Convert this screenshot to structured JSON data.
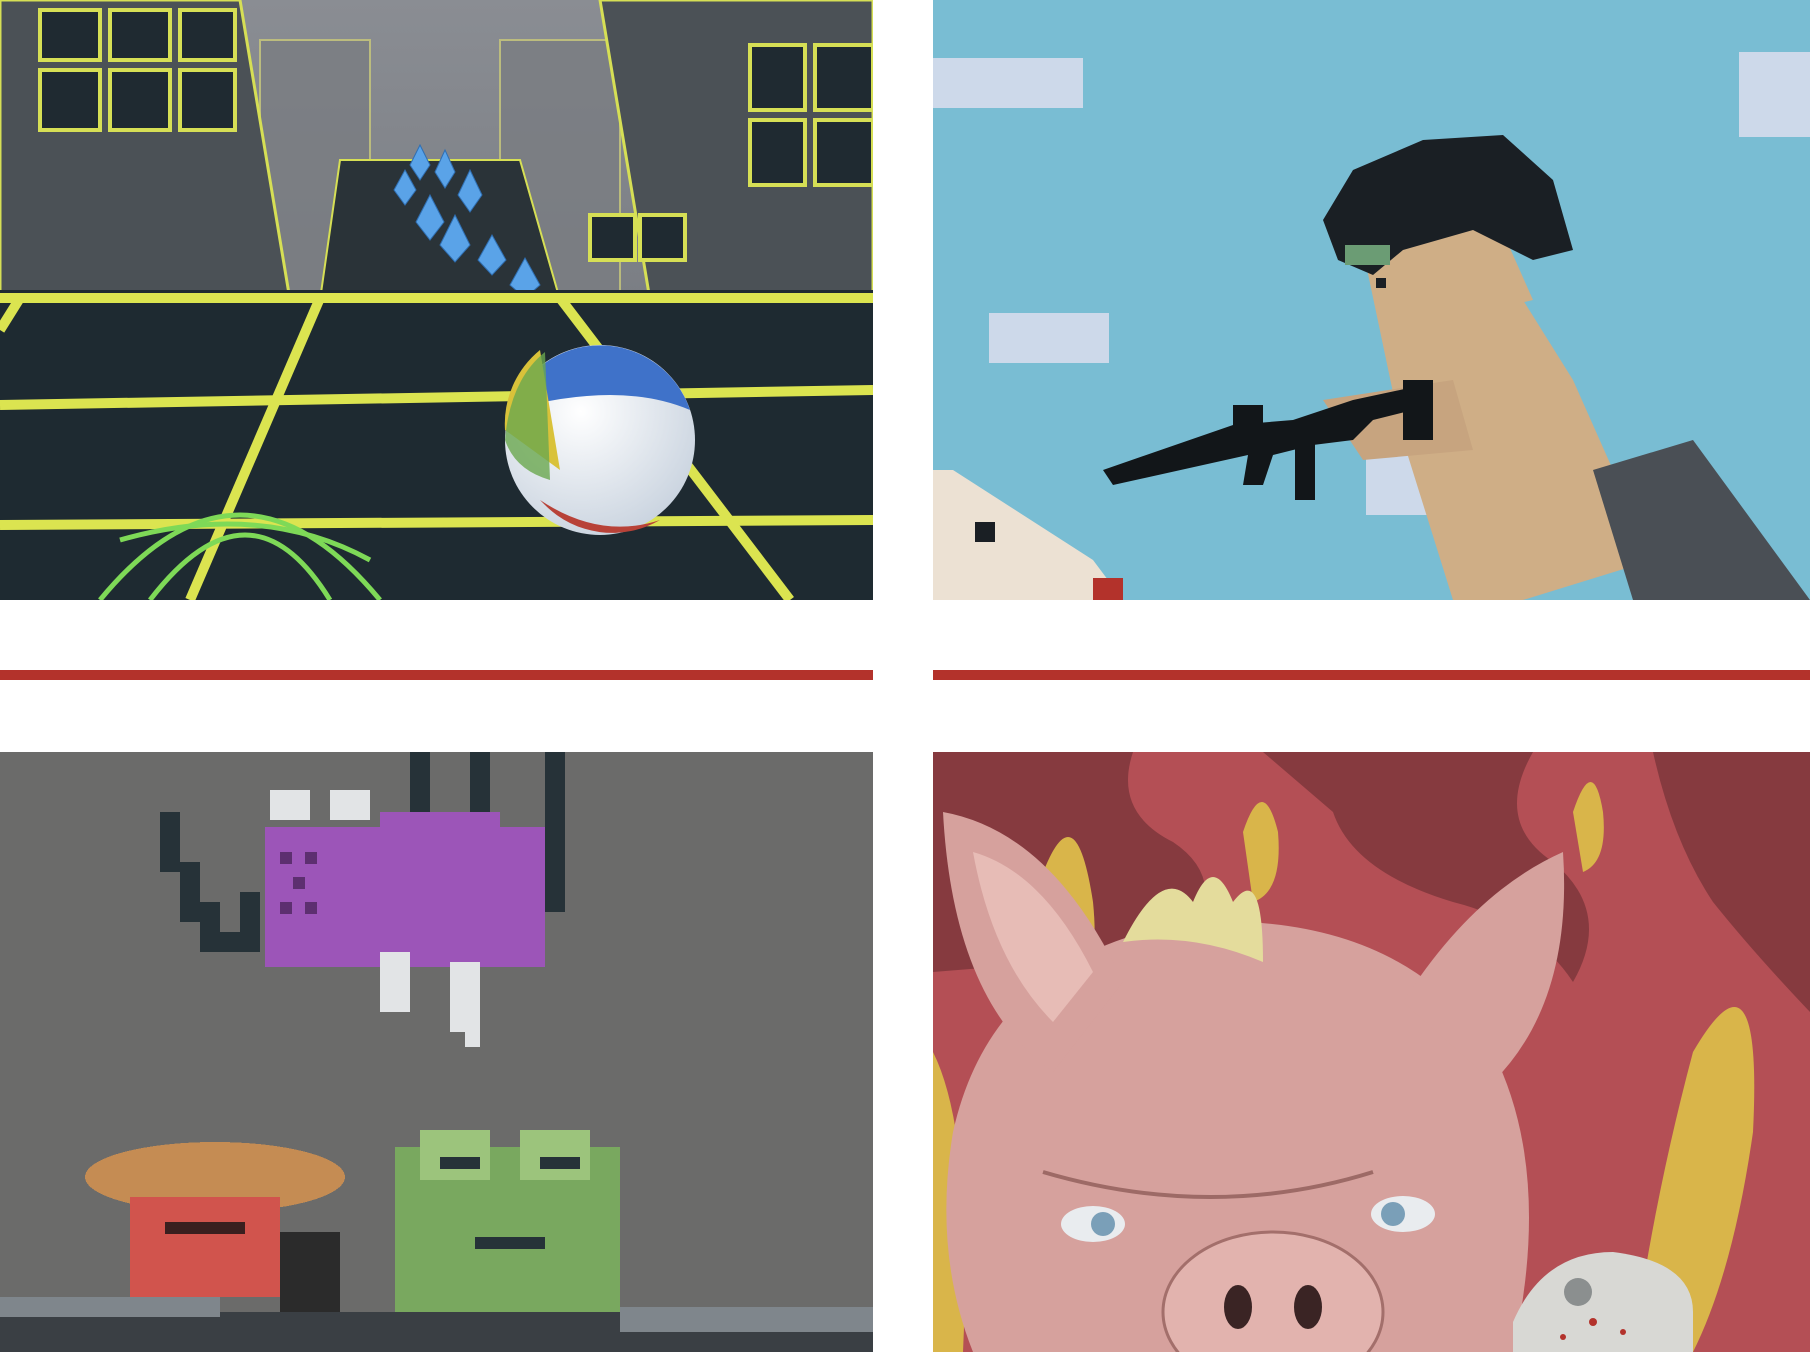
{
  "grid": {
    "games": [
      {
        "art": "neon-city-ball-rolling-game-thumbnail"
      },
      {
        "art": "pixel-shooter-with-rifle-game-thumbnail"
      },
      {
        "art": "pixel-creatures-purple-bug-frog-game-thumbnail"
      },
      {
        "art": "angry-pig-flames-game-thumbnail"
      }
    ],
    "divider_color": "#b3322b"
  }
}
